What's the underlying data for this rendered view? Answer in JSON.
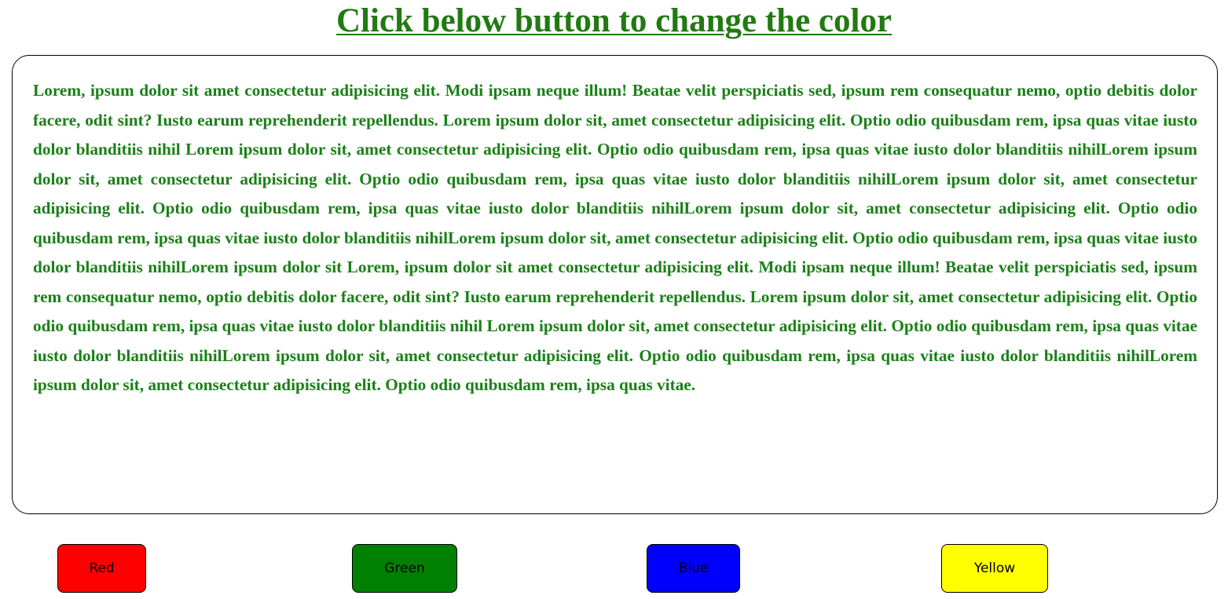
{
  "header": {
    "title": "Click below button to change the color"
  },
  "content": {
    "paragraph": "Lorem, ipsum dolor sit amet consectetur adipisicing elit. Modi ipsam neque illum! Beatae velit perspiciatis sed, ipsum rem consequatur nemo, optio debitis dolor facere, odit sint? Iusto earum reprehenderit repellendus. Lorem ipsum dolor sit, amet consectetur adipisicing elit. Optio odio quibusdam rem, ipsa quas vitae iusto dolor blanditiis nihil Lorem ipsum dolor sit, amet consectetur adipisicing elit. Optio odio quibusdam rem, ipsa quas vitae iusto dolor blanditiis nihilLorem ipsum dolor sit, amet consectetur adipisicing elit. Optio odio quibusdam rem, ipsa quas vitae iusto dolor blanditiis nihilLorem ipsum dolor sit, amet consectetur adipisicing elit. Optio odio quibusdam rem, ipsa quas vitae iusto dolor blanditiis nihilLorem ipsum dolor sit, amet consectetur adipisicing elit. Optio odio quibusdam rem, ipsa quas vitae iusto dolor blanditiis nihilLorem ipsum dolor sit, amet consectetur adipisicing elit. Optio odio quibusdam rem, ipsa quas vitae iusto dolor blanditiis nihilLorem ipsum dolor sit Lorem, ipsum dolor sit amet consectetur adipisicing elit. Modi ipsam neque illum! Beatae velit perspiciatis sed, ipsum rem consequatur nemo, optio debitis dolor facere, odit sint? Iusto earum reprehenderit repellendus. Lorem ipsum dolor sit, amet consectetur adipisicing elit. Optio odio quibusdam rem, ipsa quas vitae iusto dolor blanditiis nihil Lorem ipsum dolor sit, amet consectetur adipisicing elit. Optio odio quibusdam rem, ipsa quas vitae iusto dolor blanditiis nihilLorem ipsum dolor sit, amet consectetur adipisicing elit. Optio odio quibusdam rem, ipsa quas vitae iusto dolor blanditiis nihilLorem ipsum dolor sit, amet consectetur adipisicing elit. Optio odio quibusdam rem, ipsa quas vitae."
  },
  "buttons": {
    "red": {
      "label": "Red",
      "color": "#ff0000"
    },
    "green": {
      "label": "Green",
      "color": "#008000"
    },
    "blue": {
      "label": "Blue",
      "color": "#0000ff"
    },
    "yellow": {
      "label": "Yellow",
      "color": "#ffff00"
    }
  },
  "colors": {
    "title_text": "#217a12",
    "body_text": "#1a8017"
  }
}
